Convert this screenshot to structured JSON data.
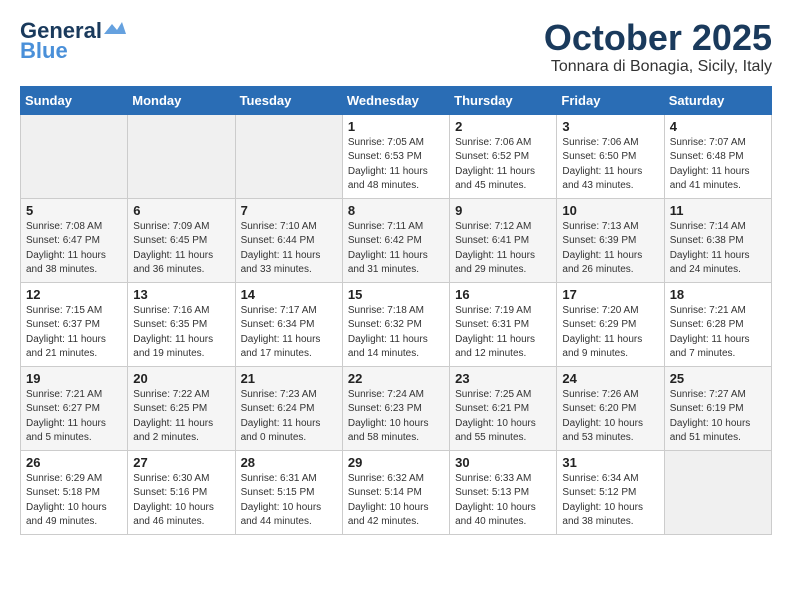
{
  "header": {
    "logo_general": "General",
    "logo_blue": "Blue",
    "month_title": "October 2025",
    "subtitle": "Tonnara di Bonagia, Sicily, Italy"
  },
  "days_of_week": [
    "Sunday",
    "Monday",
    "Tuesday",
    "Wednesday",
    "Thursday",
    "Friday",
    "Saturday"
  ],
  "weeks": [
    [
      {
        "day": "",
        "info": ""
      },
      {
        "day": "",
        "info": ""
      },
      {
        "day": "",
        "info": ""
      },
      {
        "day": "1",
        "info": "Sunrise: 7:05 AM\nSunset: 6:53 PM\nDaylight: 11 hours\nand 48 minutes."
      },
      {
        "day": "2",
        "info": "Sunrise: 7:06 AM\nSunset: 6:52 PM\nDaylight: 11 hours\nand 45 minutes."
      },
      {
        "day": "3",
        "info": "Sunrise: 7:06 AM\nSunset: 6:50 PM\nDaylight: 11 hours\nand 43 minutes."
      },
      {
        "day": "4",
        "info": "Sunrise: 7:07 AM\nSunset: 6:48 PM\nDaylight: 11 hours\nand 41 minutes."
      }
    ],
    [
      {
        "day": "5",
        "info": "Sunrise: 7:08 AM\nSunset: 6:47 PM\nDaylight: 11 hours\nand 38 minutes."
      },
      {
        "day": "6",
        "info": "Sunrise: 7:09 AM\nSunset: 6:45 PM\nDaylight: 11 hours\nand 36 minutes."
      },
      {
        "day": "7",
        "info": "Sunrise: 7:10 AM\nSunset: 6:44 PM\nDaylight: 11 hours\nand 33 minutes."
      },
      {
        "day": "8",
        "info": "Sunrise: 7:11 AM\nSunset: 6:42 PM\nDaylight: 11 hours\nand 31 minutes."
      },
      {
        "day": "9",
        "info": "Sunrise: 7:12 AM\nSunset: 6:41 PM\nDaylight: 11 hours\nand 29 minutes."
      },
      {
        "day": "10",
        "info": "Sunrise: 7:13 AM\nSunset: 6:39 PM\nDaylight: 11 hours\nand 26 minutes."
      },
      {
        "day": "11",
        "info": "Sunrise: 7:14 AM\nSunset: 6:38 PM\nDaylight: 11 hours\nand 24 minutes."
      }
    ],
    [
      {
        "day": "12",
        "info": "Sunrise: 7:15 AM\nSunset: 6:37 PM\nDaylight: 11 hours\nand 21 minutes."
      },
      {
        "day": "13",
        "info": "Sunrise: 7:16 AM\nSunset: 6:35 PM\nDaylight: 11 hours\nand 19 minutes."
      },
      {
        "day": "14",
        "info": "Sunrise: 7:17 AM\nSunset: 6:34 PM\nDaylight: 11 hours\nand 17 minutes."
      },
      {
        "day": "15",
        "info": "Sunrise: 7:18 AM\nSunset: 6:32 PM\nDaylight: 11 hours\nand 14 minutes."
      },
      {
        "day": "16",
        "info": "Sunrise: 7:19 AM\nSunset: 6:31 PM\nDaylight: 11 hours\nand 12 minutes."
      },
      {
        "day": "17",
        "info": "Sunrise: 7:20 AM\nSunset: 6:29 PM\nDaylight: 11 hours\nand 9 minutes."
      },
      {
        "day": "18",
        "info": "Sunrise: 7:21 AM\nSunset: 6:28 PM\nDaylight: 11 hours\nand 7 minutes."
      }
    ],
    [
      {
        "day": "19",
        "info": "Sunrise: 7:21 AM\nSunset: 6:27 PM\nDaylight: 11 hours\nand 5 minutes."
      },
      {
        "day": "20",
        "info": "Sunrise: 7:22 AM\nSunset: 6:25 PM\nDaylight: 11 hours\nand 2 minutes."
      },
      {
        "day": "21",
        "info": "Sunrise: 7:23 AM\nSunset: 6:24 PM\nDaylight: 11 hours\nand 0 minutes."
      },
      {
        "day": "22",
        "info": "Sunrise: 7:24 AM\nSunset: 6:23 PM\nDaylight: 10 hours\nand 58 minutes."
      },
      {
        "day": "23",
        "info": "Sunrise: 7:25 AM\nSunset: 6:21 PM\nDaylight: 10 hours\nand 55 minutes."
      },
      {
        "day": "24",
        "info": "Sunrise: 7:26 AM\nSunset: 6:20 PM\nDaylight: 10 hours\nand 53 minutes."
      },
      {
        "day": "25",
        "info": "Sunrise: 7:27 AM\nSunset: 6:19 PM\nDaylight: 10 hours\nand 51 minutes."
      }
    ],
    [
      {
        "day": "26",
        "info": "Sunrise: 6:29 AM\nSunset: 5:18 PM\nDaylight: 10 hours\nand 49 minutes."
      },
      {
        "day": "27",
        "info": "Sunrise: 6:30 AM\nSunset: 5:16 PM\nDaylight: 10 hours\nand 46 minutes."
      },
      {
        "day": "28",
        "info": "Sunrise: 6:31 AM\nSunset: 5:15 PM\nDaylight: 10 hours\nand 44 minutes."
      },
      {
        "day": "29",
        "info": "Sunrise: 6:32 AM\nSunset: 5:14 PM\nDaylight: 10 hours\nand 42 minutes."
      },
      {
        "day": "30",
        "info": "Sunrise: 6:33 AM\nSunset: 5:13 PM\nDaylight: 10 hours\nand 40 minutes."
      },
      {
        "day": "31",
        "info": "Sunrise: 6:34 AM\nSunset: 5:12 PM\nDaylight: 10 hours\nand 38 minutes."
      },
      {
        "day": "",
        "info": ""
      }
    ]
  ]
}
